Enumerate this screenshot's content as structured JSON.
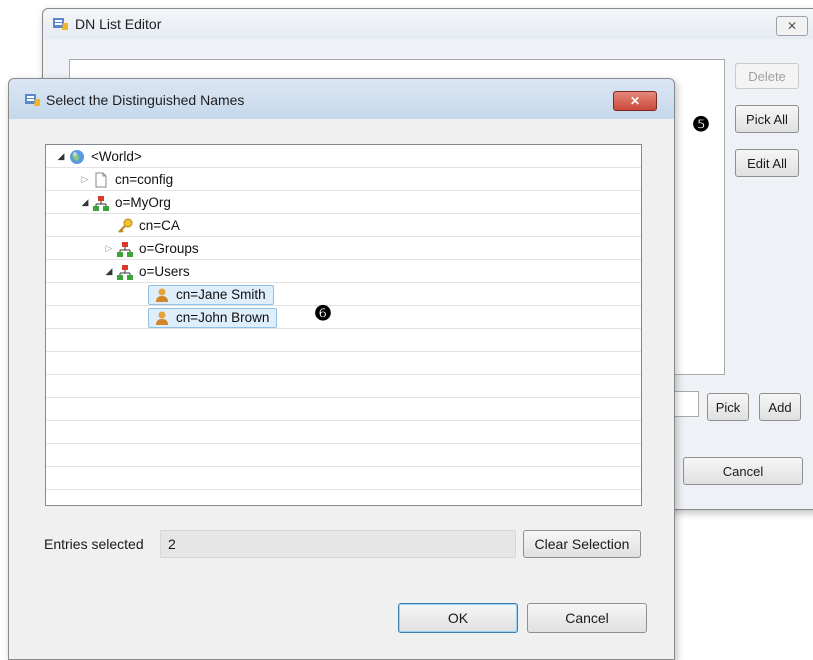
{
  "back_window": {
    "title": "DN List Editor",
    "buttons": {
      "delete": "Delete",
      "pick_all": "Pick All",
      "edit_all": "Edit All",
      "pick": "Pick",
      "add": "Add",
      "cancel": "Cancel"
    }
  },
  "dialog": {
    "title": "Select the Distinguished Names",
    "tree": [
      {
        "label": "<World>",
        "icon": "globe-icon",
        "expanded": true
      },
      {
        "label": "cn=config",
        "icon": "document-icon",
        "expanded": false
      },
      {
        "label": "o=MyOrg",
        "icon": "org-icon",
        "expanded": true
      },
      {
        "label": "cn=CA",
        "icon": "key-icon"
      },
      {
        "label": "o=Groups",
        "icon": "org-icon",
        "expanded": false
      },
      {
        "label": "o=Users",
        "icon": "org-icon",
        "expanded": true
      },
      {
        "label": "cn=Jane Smith",
        "icon": "user-icon",
        "selected": true
      },
      {
        "label": "cn=John Brown",
        "icon": "user-icon",
        "selected": true
      }
    ],
    "entries_label": "Entries selected",
    "entries_count": "2",
    "clear_selection": "Clear Selection",
    "ok": "OK",
    "cancel": "Cancel"
  },
  "callouts": {
    "five": "❺",
    "six": "❻"
  },
  "colors": {
    "selection_bg": "#dfeefb",
    "close_red": "#c9493a"
  }
}
